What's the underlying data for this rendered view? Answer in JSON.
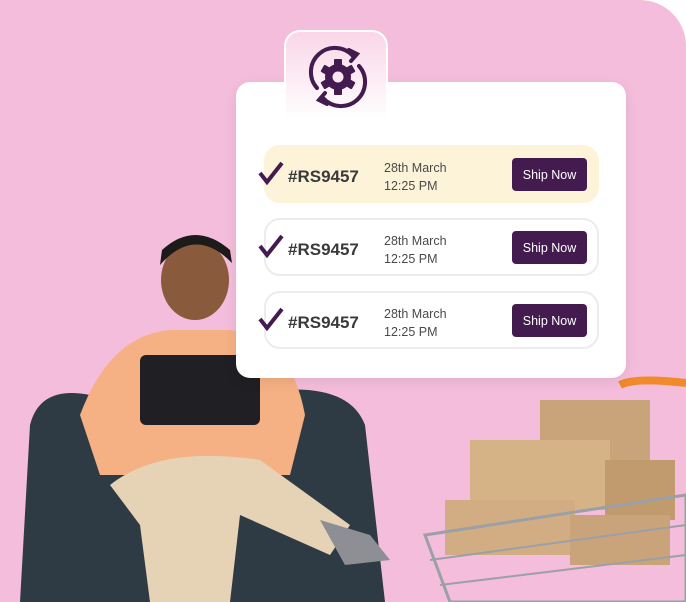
{
  "colors": {
    "background": "#f4bddb",
    "accent": "#431b4f",
    "highlight": "#fdf3d9"
  },
  "header_icon": "gear-sync-icon",
  "orders": [
    {
      "id": "#RS9457",
      "date": "28th March",
      "time": "12:25 PM",
      "action": "Ship Now",
      "highlighted": true
    },
    {
      "id": "#RS9457",
      "date": "28th March",
      "time": "12:25 PM",
      "action": "Ship Now",
      "highlighted": false
    },
    {
      "id": "#RS9457",
      "date": "28th March",
      "time": "12:25 PM",
      "action": "Ship Now",
      "highlighted": false
    }
  ]
}
